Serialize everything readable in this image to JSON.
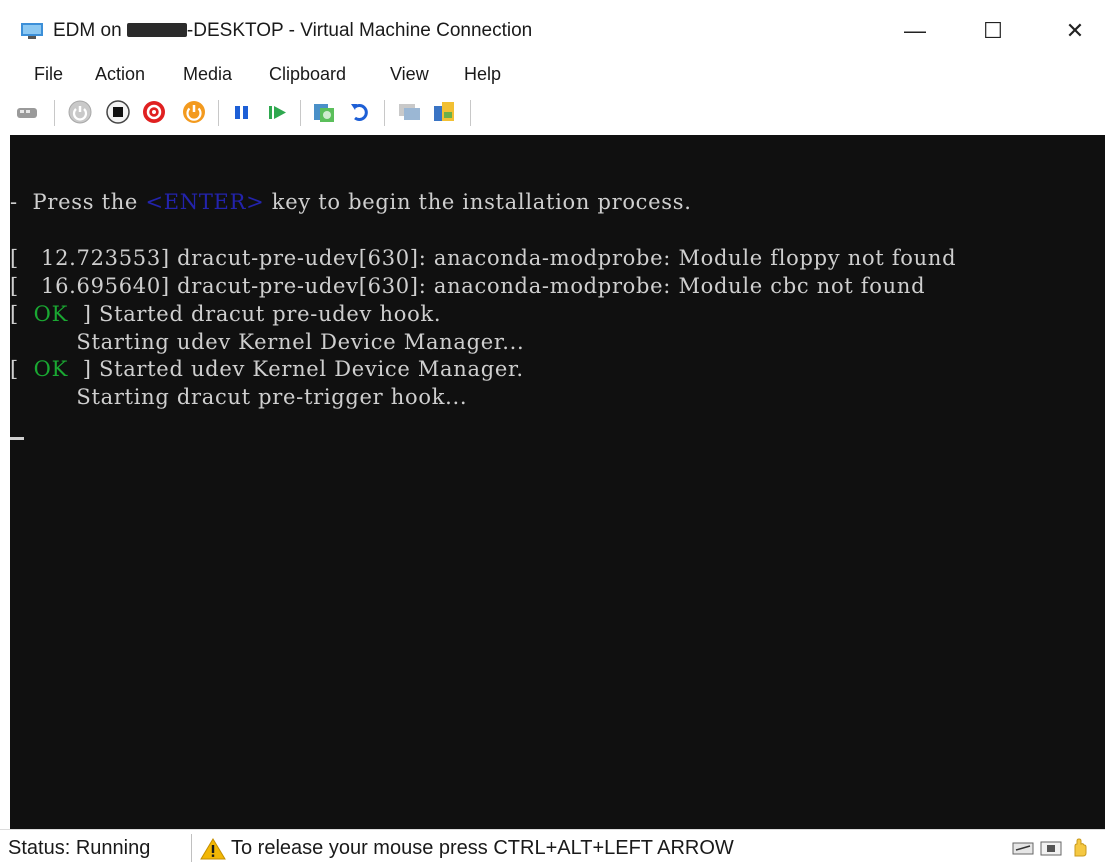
{
  "window": {
    "title_prefix": "EDM on ",
    "title_suffix": "-DESKTOP - Virtual Machine Connection",
    "controls": {
      "minimize": "—",
      "maximize": "☐",
      "close": "✕"
    }
  },
  "menu": [
    "File",
    "Action",
    "Media",
    "Clipboard",
    "View",
    "Help"
  ],
  "toolbar_icons": [
    "ctrl-alt-del-icon",
    "start-icon",
    "turn-off-icon",
    "shut-down-icon",
    "save-icon",
    "pause-icon",
    "reset-icon",
    "checkpoint-icon",
    "revert-icon",
    "enhanced-session-icon",
    "share-icon"
  ],
  "console": {
    "line1_before": "-  Press the ",
    "line1_key": "<ENTER>",
    "line1_after": " key to begin the installation process.",
    "line2": "[   12.723553] dracut-pre-udev[630]: anaconda-modprobe: Module floppy not found",
    "line3": "[   16.695640] dracut-pre-udev[630]: anaconda-modprobe: Module cbc not found",
    "line4_open": "[  ",
    "line4_ok": "OK",
    "line4_rest": "  ] Started dracut pre-udev hook.",
    "line5": "         Starting udev Kernel Device Manager...",
    "line6_open": "[  ",
    "line6_ok": "OK",
    "line6_rest": "  ] Started udev Kernel Device Manager.",
    "line7": "         Starting dracut pre-trigger hook..."
  },
  "status": {
    "label": "Status: Running",
    "message": "To release your mouse press CTRL+ALT+LEFT ARROW"
  },
  "colors": {
    "console_bg": "#101010",
    "console_text": "#cfcfcf",
    "ok": "#1aa832",
    "warn": "#f2b705"
  }
}
